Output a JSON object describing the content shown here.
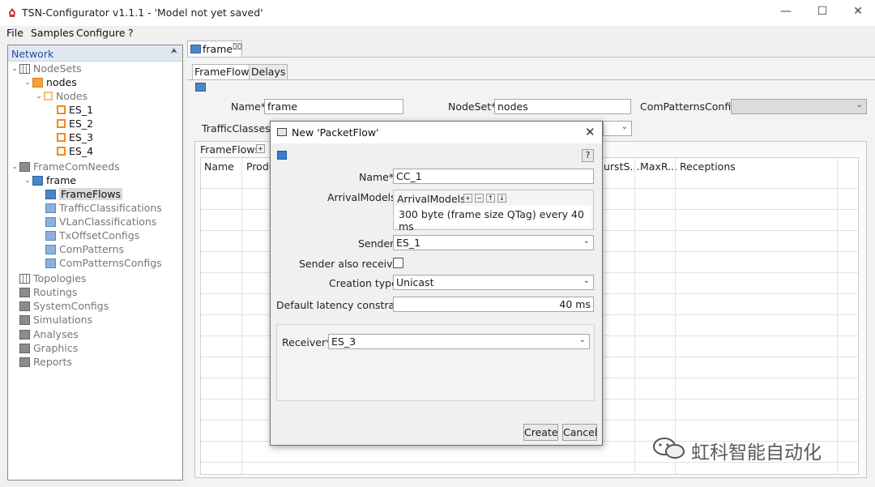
{
  "window": {
    "title": "TSN-Configurator v1.1.1 - 'Model not yet saved'",
    "icon": "rocket-app-icon"
  },
  "menu": [
    "File",
    "Samples",
    "Configure",
    "?"
  ],
  "left_panel": {
    "title": "Network",
    "tree": [
      {
        "label": "NodeSets",
        "icon": "nodesets-icon"
      },
      {
        "label": "nodes",
        "icon": "nodes-icon"
      },
      {
        "label": "Nodes",
        "icon": "nodes-folder-icon"
      },
      {
        "label": "ES_1",
        "icon": "end-station-icon"
      },
      {
        "label": "ES_2",
        "icon": "end-station-icon"
      },
      {
        "label": "ES_3",
        "icon": "end-station-icon"
      },
      {
        "label": "ES_4",
        "icon": "end-station-icon"
      },
      {
        "label": "FrameComNeeds",
        "icon": "framecomneeds-icon"
      },
      {
        "label": "frame",
        "icon": "frame-icon"
      },
      {
        "label": "FrameFlows",
        "icon": "frameflows-icon"
      },
      {
        "label": "TrafficClassifications",
        "icon": "traffic-classifications-icon"
      },
      {
        "label": "VLanClassifications",
        "icon": "vlan-classifications-icon"
      },
      {
        "label": "TxOffsetConfigs",
        "icon": "txoffset-configs-icon"
      },
      {
        "label": "ComPatterns",
        "icon": "compatterns-icon"
      },
      {
        "label": "ComPatternsConfigs",
        "icon": "compatterns-configs-icon"
      },
      {
        "label": "Topologies",
        "icon": "topologies-icon"
      },
      {
        "label": "Routings",
        "icon": "routings-icon"
      },
      {
        "label": "SystemConfigs",
        "icon": "systemconfigs-icon"
      },
      {
        "label": "Simulations",
        "icon": "simulations-icon"
      },
      {
        "label": "Analyses",
        "icon": "analyses-icon"
      },
      {
        "label": "Graphics",
        "icon": "graphics-icon"
      },
      {
        "label": "Reports",
        "icon": "reports-icon"
      }
    ]
  },
  "editor": {
    "tab": "frame",
    "subtabs": [
      "FrameFlows",
      "Delays"
    ],
    "name_label": "Name*",
    "name_value": "frame",
    "nodeset_label": "NodeSet*",
    "nodeset_value": "nodes",
    "compatterns_label": "ComPatternsConfig",
    "trafficclasses_label": "TrafficClasses",
    "frameflows_label": "FrameFlows",
    "columns": [
      "Name",
      "Produ",
      "urstS...",
      "MaxR...",
      "Receptions"
    ]
  },
  "dialog": {
    "title": "New 'PacketFlow'",
    "help": "?",
    "name_label": "Name*",
    "name_value": "CC_1",
    "arrival_label": "ArrivalModels",
    "arrival_inner_title": "ArrivalModels",
    "arrival_buttons": [
      "+",
      "−",
      "↑",
      "↓"
    ],
    "arrival_item": "300 byte (frame size QTag) every 40 ms",
    "sender_label": "Sender",
    "sender_value": "ES_1",
    "sender_receiver_label": "Sender also receiver",
    "creation_label": "Creation type",
    "creation_value": "Unicast",
    "latency_label": "Default latency constraint",
    "latency_value": "40 ms",
    "receiver_label": "Receiver*",
    "receiver_value": "ES_3",
    "create_button": "Create",
    "cancel_button": "Cancel"
  },
  "watermark": {
    "text": "虹科智能自动化"
  }
}
